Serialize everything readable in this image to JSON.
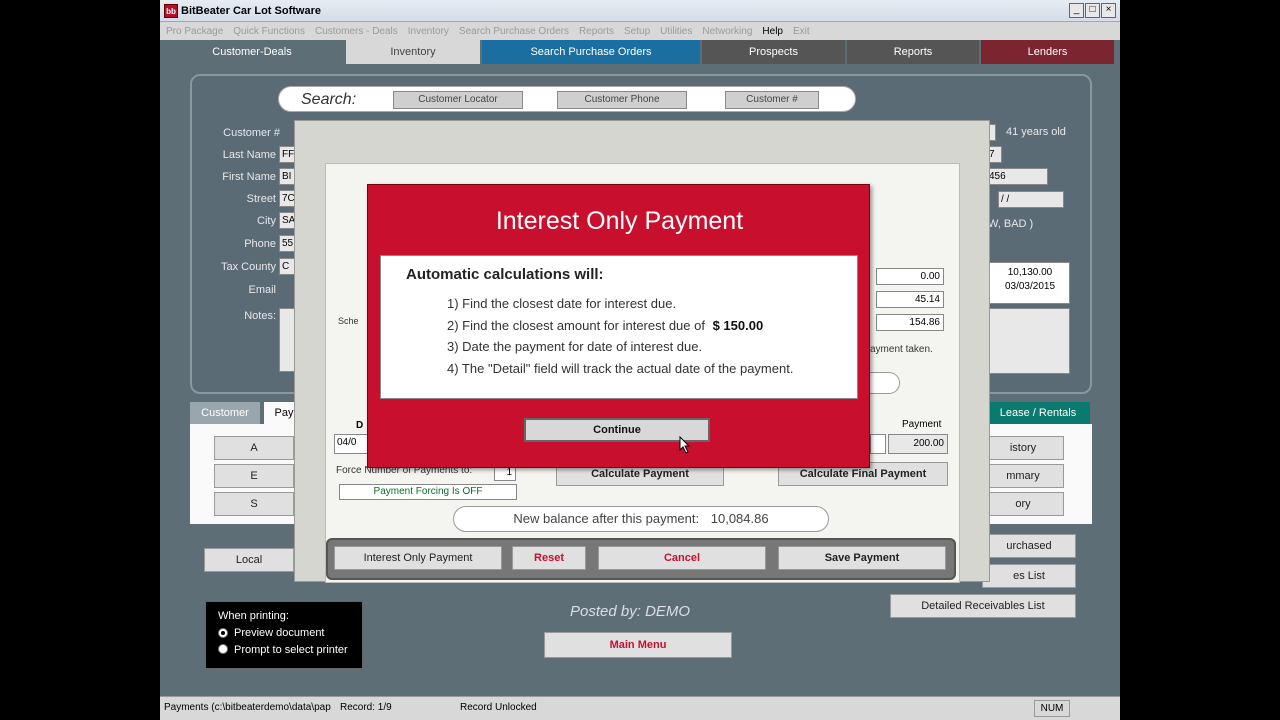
{
  "app": {
    "icon": "bb",
    "title": "BitBeater Car Lot Software"
  },
  "window_buttons": [
    "_",
    "□",
    "×"
  ],
  "menu": [
    "Pro Package",
    "Quick Functions",
    "Customers - Deals",
    "Inventory",
    "Search Purchase Orders",
    "Reports",
    "Setup",
    "Utilities",
    "Networking",
    "Help",
    "Exit"
  ],
  "tabs": [
    {
      "label": "Customer-Deals",
      "bg": "#5e6e76",
      "fg": "#ffffff"
    },
    {
      "label": "Inventory",
      "bg": "#d8d8d8",
      "fg": "#444444"
    },
    {
      "label": "Search Purchase Orders",
      "bg": "#1a6fa0",
      "fg": "#ffffff"
    },
    {
      "label": "Prospects",
      "bg": "#555555",
      "fg": "#ffffff"
    },
    {
      "label": "Reports",
      "bg": "#555555",
      "fg": "#ffffff"
    },
    {
      "label": "Lenders",
      "bg": "#7a2530",
      "fg": "#ffffff"
    }
  ],
  "search": {
    "label": "Search:",
    "buttons": [
      "Customer Locator",
      "Customer Phone",
      "Customer #"
    ]
  },
  "fields": [
    {
      "label": "Customer #",
      "value": ""
    },
    {
      "label": "Last Name",
      "value": "FF"
    },
    {
      "label": "First Name",
      "value": "BI"
    },
    {
      "label": "Street",
      "value": "7C"
    },
    {
      "label": "City",
      "value": "SA"
    },
    {
      "label": "Phone",
      "value": "55"
    },
    {
      "label": "Tax County",
      "value": "C"
    },
    {
      "label": "Email",
      "value": ""
    },
    {
      "label": "Notes:",
      "value": ""
    }
  ],
  "right_info": {
    "age": "41  years old",
    "value1": "7",
    "value2": "456",
    "value3": "/ /",
    "credit": "W, BAD )",
    "balance": "10,130.00",
    "date": "03/03/2015",
    "amount1": "0.00",
    "amount2": "45.14",
    "amount3": "154.86",
    "payment_taken": "ayment taken.",
    "sched": "Sche"
  },
  "lower_tabs": [
    {
      "label": "Customer"
    },
    {
      "label": "Pay"
    },
    {
      "label": "Lease / Rentals"
    }
  ],
  "lower_buttons_left": [
    "A",
    "E",
    "S"
  ],
  "lower_buttons_right": [
    "istory",
    "mmary",
    "ory"
  ],
  "payment": {
    "date_header": "D",
    "date_value": "04/0",
    "payment_header": "Payment",
    "payment_value": "200.00",
    "force_label": "Force Number of Payments to:",
    "force_value": "1",
    "forcing_status": "Payment Forcing Is OFF",
    "calc_btn": "Calculate Payment",
    "calc_final_btn": "Calculate Final Payment",
    "new_balance_label": "New balance after this payment:",
    "new_balance_value": "10,084.86",
    "interest_only_btn": "Interest Only Payment",
    "reset_btn": "Reset",
    "cancel_btn": "Cancel",
    "save_btn": "Save Payment"
  },
  "modal": {
    "title": "Interest Only Payment",
    "heading": "Automatic calculations will:",
    "line1": "1) Find the closest date for interest due.",
    "line2_pre": "2) Find the closest  amount for interest due of",
    "line2_amount": "$ 150.00",
    "line3": "3) Date the payment for date of interest due.",
    "line4": "4) The \"Detail\" field will track the actual date of the payment.",
    "continue_btn": "Continue"
  },
  "bottom": {
    "locate_btn": "Local",
    "posted_by_label": "Posted by:",
    "posted_by_value": "DEMO",
    "main_menu_btn": "Main Menu",
    "purchased_btn": "urchased",
    "list_btn": "es List",
    "detailed_btn": "Detailed Receivables List",
    "printing_title": "When printing:",
    "print_opt1": "Preview document",
    "print_opt2": "Prompt to select printer"
  },
  "status": {
    "path": "Payments (c:\\bitbeaterdemo\\data\\pap",
    "record": "Record: 1/9",
    "lock": "Record Unlocked",
    "num": "NUM"
  }
}
